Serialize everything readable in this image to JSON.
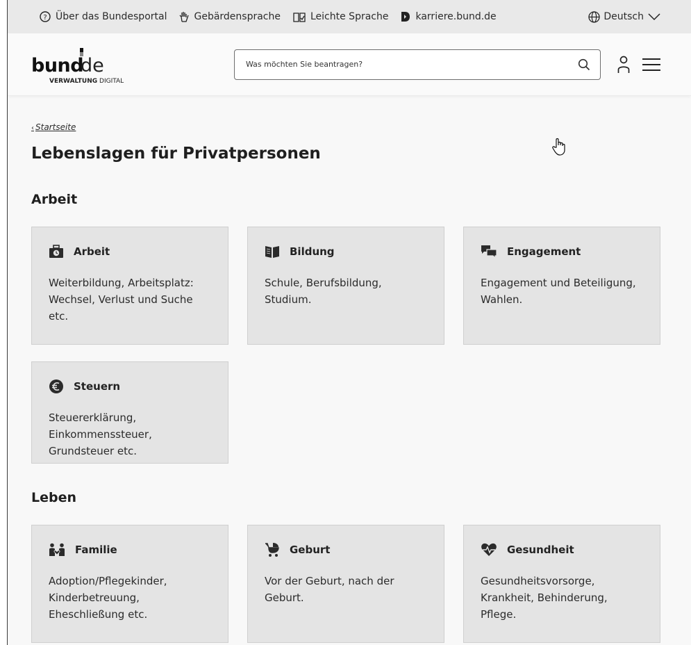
{
  "metabar": {
    "about": "Über das Bundesportal",
    "sign_language": "Gebärdensprache",
    "easy_language": "Leichte Sprache",
    "career": "karriere.bund.de",
    "language": "Deutsch"
  },
  "header": {
    "logo_main": "bund",
    "logo_tld": "de",
    "logo_sub_bold": "VERWALTUNG",
    "logo_sub": " DIGITAL",
    "search_placeholder": "Was möchten Sie beantragen?"
  },
  "breadcrumb": {
    "label": "Startseite"
  },
  "page_title": "Lebenslagen für Privatpersonen",
  "sections": [
    {
      "title": "Arbeit",
      "cards": [
        {
          "title": "Arbeit",
          "icon": "briefcase-clock-icon",
          "text": "Weiterbildung, Arbeitsplatz: Wechsel, Verlust und Suche etc."
        },
        {
          "title": "Bildung",
          "icon": "book-icon",
          "text": "Schule, Berufsbildung, Studium."
        },
        {
          "title": "Engagement",
          "icon": "speech-bubbles-icon",
          "text": "Engagement und Beteiligung, Wahlen."
        },
        {
          "title": "Steuern",
          "icon": "euro-coin-icon",
          "text": "Steuererklärung, Einkommenssteuer, Grundsteuer etc."
        }
      ]
    },
    {
      "title": "Leben",
      "cards": [
        {
          "title": "Familie",
          "icon": "family-icon",
          "text": "Adoption/Pflegekinder, Kinderbetreuung, Eheschließung etc."
        },
        {
          "title": "Geburt",
          "icon": "stroller-icon",
          "text": "Vor der Geburt, nach der Geburt."
        },
        {
          "title": "Gesundheit",
          "icon": "heart-pulse-icon",
          "text": "Gesundheitsvorsorge, Krankheit, Behinderung, Pflege."
        }
      ]
    }
  ],
  "colors": {
    "card_bg": "#e4e4e4",
    "metabar_bg": "#e9e9e9",
    "text": "#2b2b2b"
  }
}
